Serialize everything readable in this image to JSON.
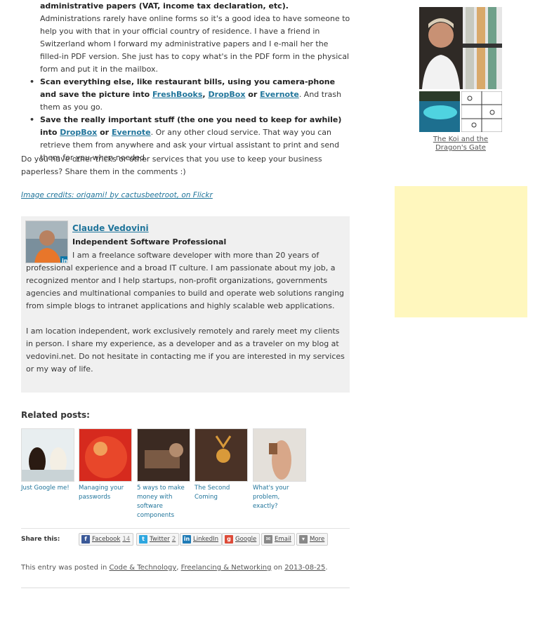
{
  "article": {
    "bullets": [
      {
        "bold": "administrative papers (VAT, income tax declaration, etc).",
        "text": " Administrations rarely have online forms so it's a good idea to have someone to help you with that in your official country of residence. I have a friend in Switzerland whom I forward my administrative papers and I e-mail her the filled-in PDF version. She just has to copy what's in the PDF form in the physical form and put it in the mailbox."
      },
      {
        "bold_before": "Scan everything else, like restaurant bills, using you camera-phone and save the picture into ",
        "link1": "FreshBooks",
        "sep1": ", ",
        "link2": "DropBox",
        "sep2": " or ",
        "link3": "Evernote",
        "text": ". And trash them as you go."
      },
      {
        "bold_before": "Save the really important stuff (the one you need to keep for awhile) into ",
        "link1": "DropBox",
        "sep1": " or ",
        "link2": "Evernote",
        "text": ". Or any other cloud service. That way you can retrieve them from anywhere and ask your virtual assistant to print and send them for you when needed."
      }
    ],
    "question": "Do you have other tricks or other services that you use to keep your business paperless? Share them in the comments :)",
    "image_credits": "Image credits: origami! by cactusbeetroot, on Flickr"
  },
  "author": {
    "name": "Claude Vedovini",
    "role": "Independent Software Professional",
    "bio_p1": "I am a freelance software developer with more than 20 years of professional experience and a broad IT culture. I am passionate about my job, a recognized mentor and I help startups, non-profit organizations, governments agencies and multinational companies to build and operate web solutions ranging from simple blogs to intranet applications and highly scalable web applications.",
    "bio_p2": "I am location independent, work exclusively remotely and rarely meet my clients in person. I share my experience, as a developer and as a traveler on my blog at vedovini.net. Do not hesitate in contacting me if you are interested in my services or my way of life."
  },
  "related": {
    "title": "Related posts:",
    "items": [
      {
        "caption": "Just Google me!"
      },
      {
        "caption": "Managing your passwords"
      },
      {
        "caption": "5 ways to make money with software components"
      },
      {
        "caption": "The Second Coming"
      },
      {
        "caption": "What's your problem, exactly?"
      }
    ]
  },
  "share": {
    "label": "Share this:",
    "buttons": [
      {
        "label": "Facebook",
        "count": "14",
        "icon": "facebook-icon",
        "color": "#3b5998"
      },
      {
        "label": "Twitter",
        "count": "2",
        "icon": "twitter-icon",
        "color": "#2ea7e0"
      },
      {
        "label": "LinkedIn",
        "count": "",
        "icon": "linkedin-icon",
        "color": "#1f7bb6"
      },
      {
        "label": "Google",
        "count": "",
        "icon": "google-plus-icon",
        "color": "#dd4b39"
      },
      {
        "label": "Email",
        "count": "",
        "icon": "email-icon",
        "color": "#888888"
      },
      {
        "label": "More",
        "count": "",
        "icon": "more-icon",
        "color": "#888888"
      }
    ]
  },
  "entry_meta": {
    "prefix": "This entry was posted in ",
    "cat1": "Code & Technology",
    "sep": ", ",
    "cat2": "Freelancing & Networking",
    "on": " on ",
    "date": "2013-08-25",
    "end": "."
  },
  "sidebar": {
    "gallery_caption": "The Koi and the Dragon's Gate"
  },
  "colors": {
    "link": "#21759b",
    "author_box_bg": "#f0f0f0",
    "ad_bg": "#fff7be"
  }
}
